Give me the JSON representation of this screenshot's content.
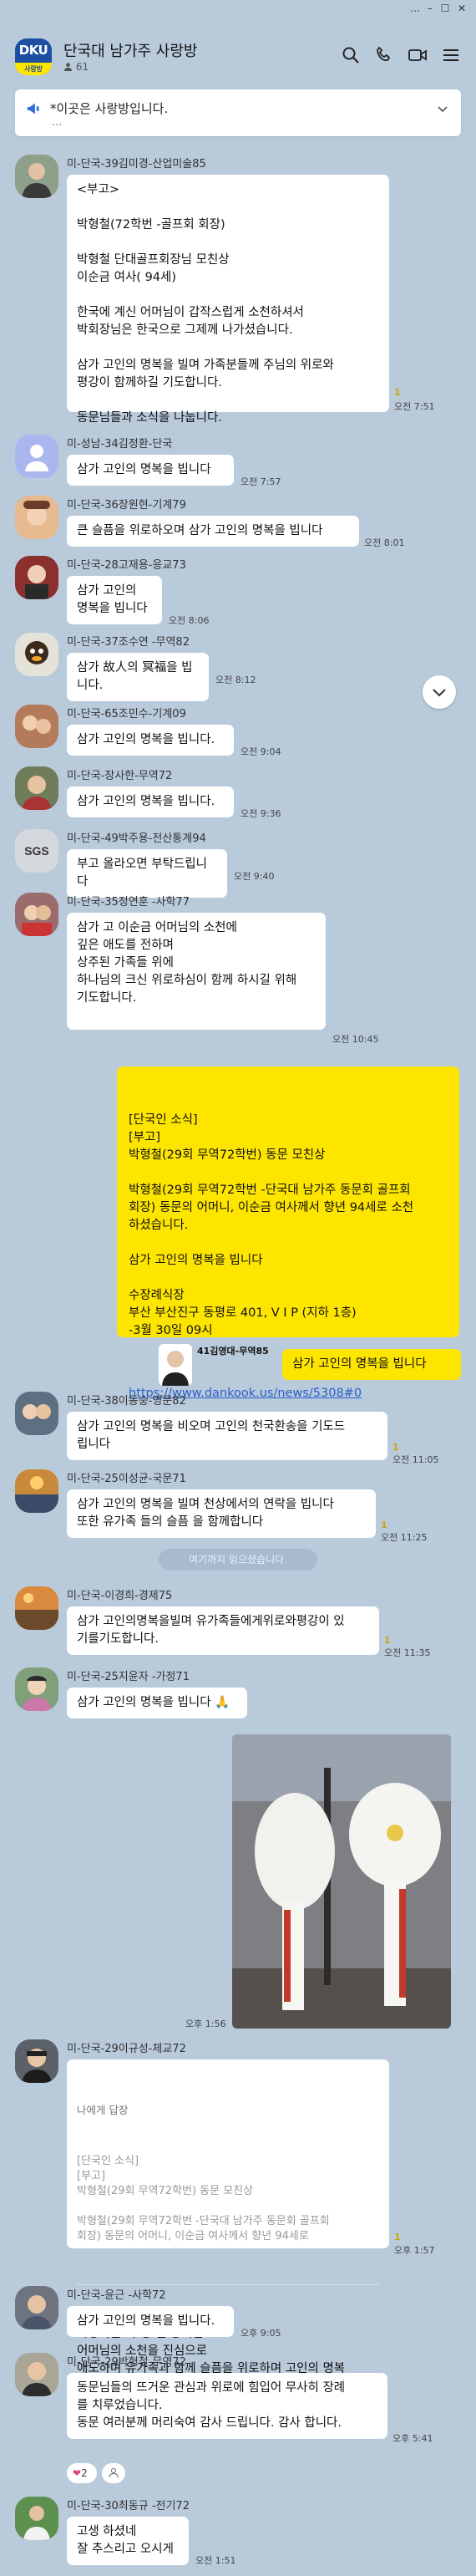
{
  "header": {
    "logo_line1": "DKU",
    "logo_line2": "사랑방",
    "title": "단국대 남가주 사랑방",
    "member_count": "61"
  },
  "notice": {
    "text": "*이곳은 사랑방입니다.",
    "more": "..."
  },
  "divider": "여기까지 읽으셨습니다.",
  "messages": [
    {
      "sender": "미-단국-39김미경-산업미술85",
      "text": "<부고>\n\n박형철(72학번 -골프회 회장)\n\n박형철 단대골프회장님 모친상\n이순금 여사( 94세)\n\n한국에 계신 어머님이 갑작스럽게 소천하셔서\n박회장님은 한국으로 그제께 나가셨습니다.\n\n삼가 고인의 명복을 빌며 가족분들께 주님의 위로와\n평강이 함께하길 기도합니다.\n\n동문님들과 소식을 나눕니다.",
      "time": "오전 7:51"
    },
    {
      "sender": "미-성남-34김정환-단국",
      "text": "삼가 고인의 명복을 빕니다",
      "time": "오전 7:57"
    },
    {
      "sender": "미-단국-36장원현-기계79",
      "text": "큰 슬픔을 위로하오며 삼가 고인의 명복을 빕니다",
      "time": "오전 8:01"
    },
    {
      "sender": "미-단국-28고재용-응교73",
      "text": "삼가 고인의\n명복을 빕니다",
      "time": "오전 8:06"
    },
    {
      "sender": "미-단국-37조수연 -무역82",
      "text": "삼가 故人의 冥福을 빕니다.",
      "time": "오전 8:12"
    },
    {
      "sender": "미-단국-65조민수-기계09",
      "text": "삼가 고인의 명복을 빕니다.",
      "time": "오전 9:04"
    },
    {
      "sender": "미-단국-장사한-무역72",
      "text": "삼가 고인의 명복을 빕니다.",
      "time": "오전 9:36"
    },
    {
      "sender": "미-단국-49박주용-전산통계94",
      "text": "부고 올라오면 부탁드립니다",
      "time": "오전 9:40"
    },
    {
      "sender": "미-단국-35정연훈 -사학77",
      "text": "삼가 고 이순금 어머님의 소천에\n깊은 애도를 전하며\n상주된 가족들 위에\n하나님의 크신 위로하심이 함께 하시길 위해\n기도합니다.",
      "time": "오전 10:45"
    },
    {
      "sender": "",
      "text": "[단국인 소식]\n[부고]\n박형철(29회 무역72학번) 동문 모친상\n\n박형철(29회 무역72학번 -단국대 남가주 동문회 골프회\n회장) 동문의 어머니, 이순금 여사께서 향년 94세로 소천\n하셨습니다.\n\n삼가 고인의 명복을 빕니다\n\n수장례식장\n부산 부산진구 동평로 401, V I P (지하 1층)\n-3월 30일 09시",
      "link": "https://www.dankook.us/news/5308#0",
      "time": ""
    },
    {
      "sender": "41김영대-무역85",
      "text": "삼가 고인의 명복을 빕니다",
      "time": ""
    },
    {
      "sender": "미-단국-38이동숭-영문82",
      "text": "삼가 고인의 명복을 비오며 고인의 천국환송을 기도드\n립니다",
      "time": "오전 11:05"
    },
    {
      "sender": "미-단국-25이성균-국문71",
      "text": "삼가 고인의 명복을 빌며 천상에서의 연락을 빕니다\n또한 유가족 들의 슬픔 을 함께합니다",
      "time": "오전 11:25"
    },
    {
      "sender": "미-단국-이경희-경제75",
      "text": "삼가 고인의명복을빌며 유가족들에게위로와평강이 있\n기를기도합니다.",
      "time": "오전 11:35"
    },
    {
      "sender": "미-단국-25지윤자 -가정71",
      "text": "삼가 고인의 명복을 빕니다 🙏",
      "time": "오후 1:56"
    },
    {
      "sender": "미-단국-29이규성-체교72",
      "reply_header": "나에게 답장",
      "reply_quote": "[단국인 소식]\n[부고]\n박형철(29회 무역72학번) 동문 모친상\n\n박형철(29회 무역72학번 -단국대 남가주 동문회 골프회\n회장) 동문의 어머니, 이순금 여사께서 향년 94세로",
      "text": "사랑하는 박 형 철 동기님\n어머님의 소천을 진심으로\n애도하며 유가족과 함께 슬픔을 위로하며 고인의 명복\n을 빕니다.",
      "time": "오후 1:57"
    },
    {
      "sender": "미-단국-윤근 -사학72",
      "text": "삼가 고인의 명복을 빕니다.",
      "time": "오후 9:05"
    },
    {
      "sender": "미-단국-29박형철-무역72",
      "text": "동문님들의 뜨거운 관심과 위로에 힘입어 무사히 장례\n를 치루었습니다.\n동문 여러분께 머리숙여 감사 드립니다. 감사 합니다.",
      "time": "오후 5:41",
      "reaction_count": "2"
    },
    {
      "sender": "미-단국-30최동규 -전기72",
      "text": "고생 하셨네\n잘 추스리고 오시게",
      "time": "오전 1:51"
    }
  ],
  "read_counts": [
    "1",
    "1",
    "1",
    "1",
    "1"
  ],
  "colors": {
    "background": "#b9cadb",
    "my_bubble": "#fee500",
    "other_bubble": "#ffffff",
    "link": "#2a5ec9"
  },
  "icons": {
    "search": "search-icon",
    "call": "phone-icon",
    "video": "video-icon",
    "menu": "menu-icon",
    "notice": "megaphone-icon",
    "scroll": "chevron-down-icon"
  }
}
